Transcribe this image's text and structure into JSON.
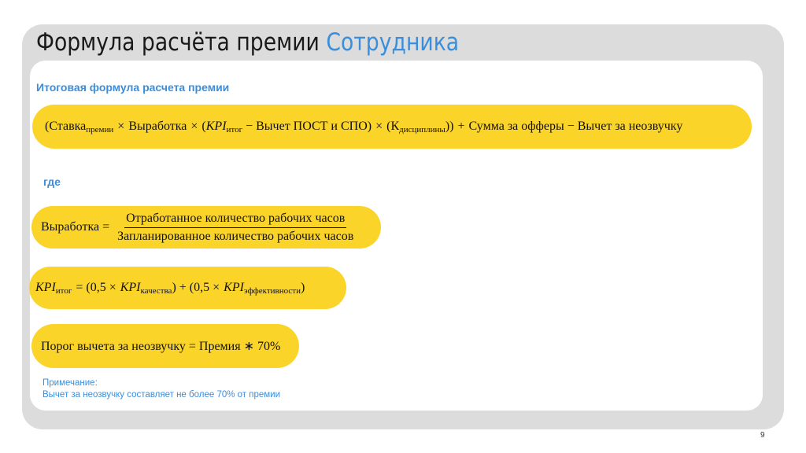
{
  "slide": {
    "title_main": "Формула расчёта премии",
    "title_accent": "Сотрудника",
    "subheading": "Итоговая формула расчета премии",
    "where_label": "где",
    "page_number": "9"
  },
  "formula_main": {
    "open": "(Ставка",
    "premium_sub": "премии",
    "times1": "×",
    "output_word": "Выработка",
    "times2": "×",
    "open2": "(",
    "kpi": "KPI",
    "kpi_sub": "итог",
    "minus_deduction": "− Вычет ПОСТ и СПО)",
    "times3": "×",
    "k_open": "(К",
    "k_sub": "дисциплины",
    "close": "))",
    "plus": "+",
    "tail": "Сумма за офферы − Вычет за неозвучку"
  },
  "formula_output": {
    "lhs": "Выработка =",
    "numerator": "Отработанное количество рабочих часов",
    "denominator": "Запланированное количество рабочих часов"
  },
  "formula_kpi": {
    "kpi": "KPI",
    "kpi_sub": "итог",
    "eq_part1": "= (0,5 ×",
    "kpi_q": "KPI",
    "kpi_q_sub": "качества",
    "mid": ") + (0,5 ×",
    "kpi_e": "KPI",
    "kpi_e_sub": "эффективности",
    "close": ")"
  },
  "formula_threshold": {
    "text": "Порог вычета за неозвучку = Премия ∗ 70%"
  },
  "note": {
    "label": "Примечание:",
    "text": "Вычет за неозвучку составляет не более 70% от премии"
  },
  "colors": {
    "accent_blue": "#3a8edb",
    "formula_yellow": "#fbd42a",
    "frame_gray": "#dcdcdc"
  }
}
